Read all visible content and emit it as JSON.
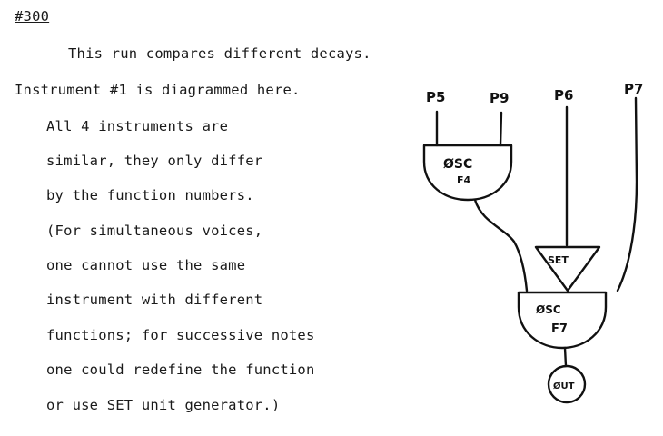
{
  "doc": {
    "number": "#300",
    "lines": [
      "This run compares different decays.",
      "Instrument #1 is diagrammed here.",
      "All 4 instruments are",
      "similar, they only differ",
      "by the function numbers.",
      "(For simultaneous voices,",
      "one cannot use the same",
      "instrument with different",
      "functions; for successive notes",
      "one could redefine the function",
      "or use SET unit generator.)"
    ]
  },
  "diagram": {
    "params": [
      "P5",
      "P9",
      "P6",
      "P7"
    ],
    "osc1": {
      "name": "ØSC",
      "func": "F4"
    },
    "set": {
      "name": "SET"
    },
    "osc2": {
      "name": "ØSC",
      "func": "F7"
    },
    "out": {
      "name": "ØUT"
    }
  }
}
